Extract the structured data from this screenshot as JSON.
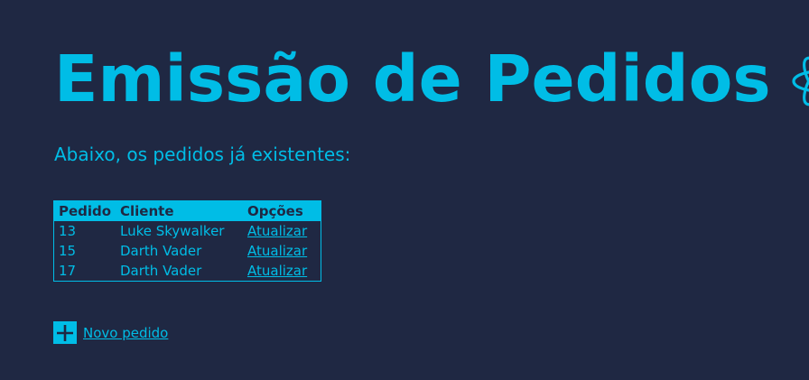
{
  "header": {
    "title": "Emissão de Pedidos",
    "logo_icon": "react-atom-icon"
  },
  "subtitle": "Abaixo, os pedidos já existentes:",
  "table": {
    "columns": [
      "Pedido",
      "Cliente",
      "Opções"
    ],
    "rows": [
      {
        "id": "13",
        "client": "Luke Skywalker",
        "action": "Atualizar"
      },
      {
        "id": "15",
        "client": "Darth Vader",
        "action": "Atualizar"
      },
      {
        "id": "17",
        "client": "Darth Vader",
        "action": "Atualizar"
      }
    ]
  },
  "new_order": {
    "icon": "plus-icon",
    "label": "Novo pedido"
  },
  "colors": {
    "background": "#1f2843",
    "accent": "#00bde6"
  }
}
